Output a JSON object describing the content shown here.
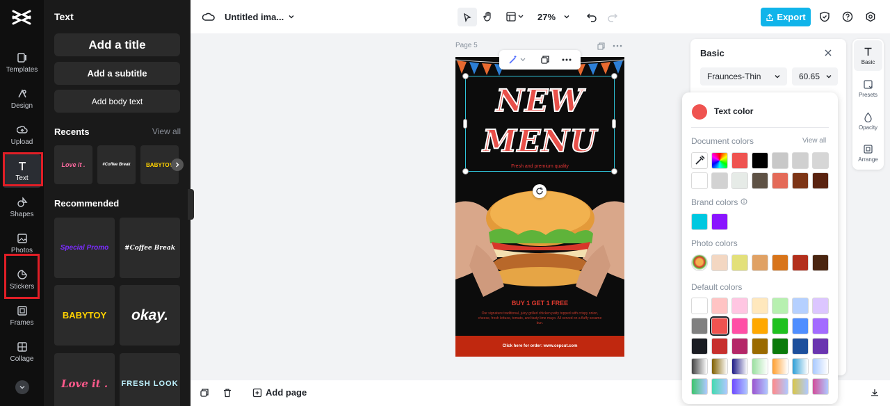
{
  "rail": {
    "items": [
      {
        "label": "Templates",
        "icon": "templates-icon"
      },
      {
        "label": "Design",
        "icon": "design-icon"
      },
      {
        "label": "Upload",
        "icon": "upload-icon"
      },
      {
        "label": "Text",
        "icon": "text-icon"
      },
      {
        "label": "Shapes",
        "icon": "shapes-icon"
      },
      {
        "label": "Photos",
        "icon": "photos-icon"
      },
      {
        "label": "Stickers",
        "icon": "stickers-icon"
      },
      {
        "label": "Frames",
        "icon": "frames-icon"
      },
      {
        "label": "Collage",
        "icon": "collage-icon"
      }
    ],
    "active": "Text",
    "highlighted": [
      "Text",
      "Stickers"
    ],
    "highlight_color": "#e01e26"
  },
  "text_panel": {
    "title": "Text",
    "add_title": "Add a title",
    "add_subtitle": "Add a subtitle",
    "add_body": "Add body text",
    "recents_label": "Recents",
    "view_all": "View all",
    "recents": [
      "Love it .",
      "#Coffee Break",
      "BABYTOY"
    ],
    "recommended_label": "Recommended",
    "recommended": [
      "Special Promo",
      "#Coffee Break",
      "BABYTOY",
      "okay.",
      "Love it .",
      "FRESH LOOK"
    ]
  },
  "topbar": {
    "doc_title": "Untitled ima...",
    "zoom": "27%",
    "export_label": "Export"
  },
  "canvas": {
    "page_label": "Page 5",
    "poster": {
      "line1": "NEW",
      "line2": "MENU",
      "tagline": "Fresh and premium quality",
      "offer": "BUY 1 GET 1 FREE",
      "offer_desc": "Our signature traditional, juicy grilled chicken patty topped with crispy onion, cheese, fresh lettuce, tomato, and tasty lime mayo. All served on a fluffy sesame bun.",
      "footer": "Click here for order:  www.cepcut.com"
    }
  },
  "bottombar": {
    "add_page": "Add page"
  },
  "basic_panel": {
    "title": "Basic",
    "font": "Fraunces-Thin",
    "size": "60.65"
  },
  "right_rail": {
    "items": [
      {
        "label": "Basic",
        "icon": "text-icon"
      },
      {
        "label": "Presets",
        "icon": "presets-icon"
      },
      {
        "label": "Opacity",
        "icon": "opacity-icon"
      },
      {
        "label": "Arrange",
        "icon": "arrange-icon"
      }
    ]
  },
  "color_picker": {
    "title": "Text color",
    "current_color": "#ef5350",
    "document_label": "Document colors",
    "view_all": "View all",
    "document_colors": [
      "#ef5350",
      "#000000",
      "#c8c8c8",
      "#d0d0d0",
      "#d6d6d6",
      "#ffffff",
      "#d2d2d2",
      "#e6ebe7",
      "#5e5245",
      "#e46a58",
      "#7d3516",
      "#5a2310"
    ],
    "brand_label": "Brand colors",
    "brand_colors": [
      "#00c8e0",
      "#8a14ff"
    ],
    "photo_label": "Photo colors",
    "photo_colors": [
      "#f3d7c2",
      "#e3e07a",
      "#e0a164",
      "#d8741a",
      "#b32f1c",
      "#4a2510"
    ],
    "default_label": "Default colors",
    "default_colors": [
      [
        "#ffffff",
        "#ffc4c4",
        "#ffc6e2",
        "#ffe8bd",
        "#b7f0b0",
        "#b5d0ff",
        "#dcc6ff"
      ],
      [
        "#808080",
        "#ef5350",
        "#ff4fa6",
        "#ffa800",
        "#1fc11f",
        "#4f8eff",
        "#a36bff"
      ],
      [
        "#1a1c22",
        "#c7302e",
        "#b42768",
        "#9a6a00",
        "#0b7a0b",
        "#1d4f9c",
        "#6a35b0"
      ],
      [
        "#444444",
        "#806000",
        "#1e1a86",
        "#9be0a0",
        "#ff9f2f",
        "#2f9fd7",
        "#a9c9ff"
      ],
      [
        "#3ec46f",
        "#46d9b1",
        "#6f4bff",
        "#9b56d1",
        "#ff8a8a",
        "#d8c64a",
        "#d24e9a"
      ]
    ]
  }
}
